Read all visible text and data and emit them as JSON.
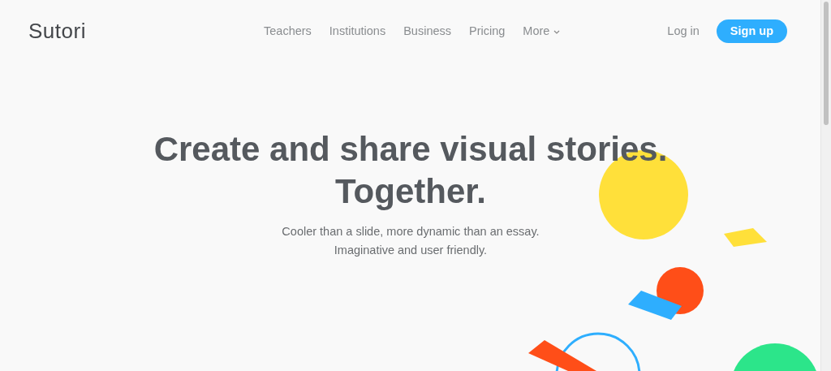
{
  "logo": "Sutori",
  "nav": [
    {
      "label": "Teachers",
      "dropdown": false
    },
    {
      "label": "Institutions",
      "dropdown": false
    },
    {
      "label": "Business",
      "dropdown": false
    },
    {
      "label": "Pricing",
      "dropdown": false
    },
    {
      "label": "More",
      "dropdown": true
    }
  ],
  "login": "Log in",
  "signup": "Sign up",
  "hero": {
    "title_lines": [
      "Create and share visual stories.",
      "Together."
    ],
    "subtitle_lines": [
      "Cooler than a slide, more dynamic than an essay.",
      "Imaginative and user friendly."
    ]
  }
}
